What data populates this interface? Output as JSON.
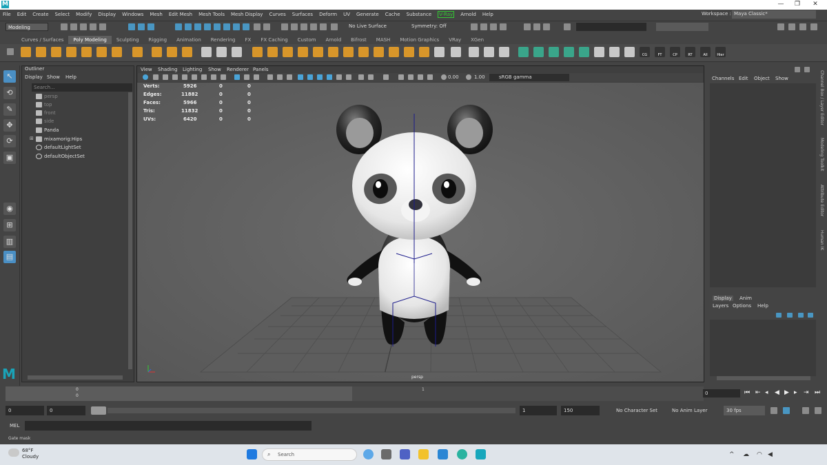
{
  "titlebar": {
    "minimize": "—",
    "maximize": "❐",
    "close": "✕"
  },
  "menu": [
    "File",
    "Edit",
    "Create",
    "Select",
    "Modify",
    "Display",
    "Windows",
    "Mesh",
    "Edit Mesh",
    "Mesh Tools",
    "Mesh Display",
    "Curves",
    "Surfaces",
    "Deform",
    "UV",
    "Generate",
    "Cache",
    "Substance",
    "V-Ray",
    "Arnold",
    "Help"
  ],
  "workspace": {
    "label": "Workspace :",
    "value": "Maya Classic*"
  },
  "status": {
    "mode": "Modeling",
    "live_surface": "No Live Surface",
    "symmetry": "Symmetry: Off"
  },
  "shelf_tabs": [
    "Curves / Surfaces",
    "Poly Modeling",
    "Sculpting",
    "Rigging",
    "Animation",
    "Rendering",
    "FX",
    "FX Caching",
    "Custom",
    "Arnold",
    "Bifrost",
    "MASH",
    "Motion Graphics",
    "VRay",
    "XGen"
  ],
  "shelf_labels": [
    "CG",
    "FT",
    "CP",
    "RT",
    "All",
    "Hier"
  ],
  "outliner": {
    "title": "Outliner",
    "menus": [
      "Display",
      "Show",
      "Help"
    ],
    "search_placeholder": "Search...",
    "items": [
      "persp",
      "top",
      "front",
      "side",
      "Panda",
      "mixamorig:Hips",
      "defaultLightSet",
      "defaultObjectSet"
    ]
  },
  "viewport": {
    "menus": [
      "View",
      "Shading",
      "Lighting",
      "Show",
      "Renderer",
      "Panels"
    ],
    "val1": "0.00",
    "val2": "1.00",
    "colorspace": "sRGB gamma",
    "camera": "persp",
    "hud": [
      {
        "label": "Verts:",
        "a": "5926",
        "b": "0",
        "c": "0"
      },
      {
        "label": "Edges:",
        "a": "11882",
        "b": "0",
        "c": "0"
      },
      {
        "label": "Faces:",
        "a": "5966",
        "b": "0",
        "c": "0"
      },
      {
        "label": "Tris:",
        "a": "11832",
        "b": "0",
        "c": "0"
      },
      {
        "label": "UVs:",
        "a": "6420",
        "b": "0",
        "c": "0"
      }
    ]
  },
  "channelbox": {
    "menus": [
      "Channels",
      "Edit",
      "Object",
      "Show"
    ],
    "side_labels": [
      "Channel Box / Layer Editor",
      "Modeling Toolkit",
      "Attribute Editor",
      "Human IK"
    ]
  },
  "layers": {
    "tabs": [
      "Display",
      "Anim"
    ],
    "menus": [
      "Layers",
      "Options",
      "Help"
    ]
  },
  "timeline": {
    "tick0": "0",
    "tick1": "0",
    "tick_mid": "1",
    "current": "0"
  },
  "range": {
    "start": "0",
    "start2": "0",
    "end_start": "1",
    "end": "150",
    "char_set": "No Character Set",
    "anim_layer": "No Anim Layer",
    "fps": "30 fps"
  },
  "cmd": {
    "mel": "MEL",
    "help": "Gate mask"
  },
  "taskbar": {
    "temp": "68°F",
    "cond": "Cloudy",
    "search": "Search"
  }
}
